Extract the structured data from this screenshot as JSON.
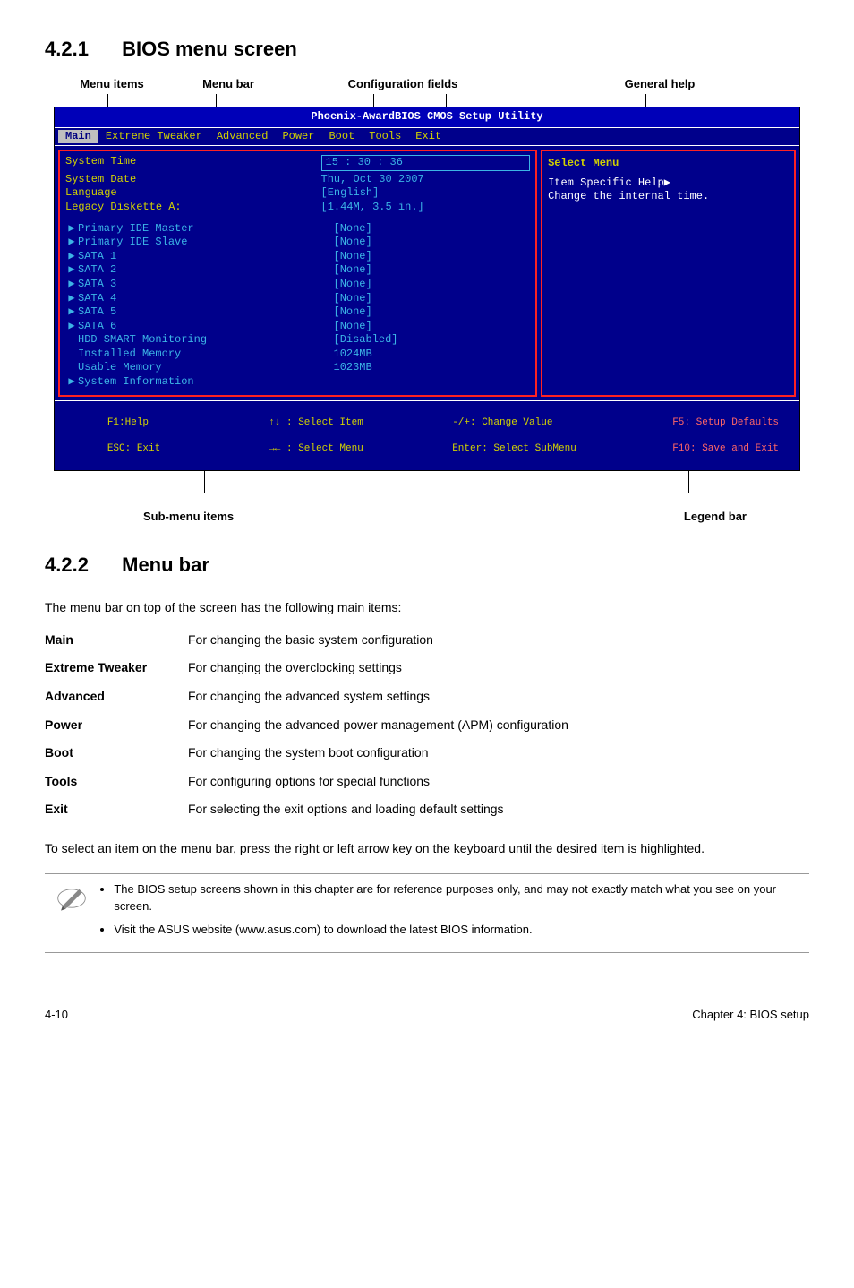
{
  "section1": {
    "number": "4.2.1",
    "title": "BIOS menu screen"
  },
  "labels_top": {
    "items": "Menu items",
    "bar": "Menu bar",
    "fields": "Configuration fields",
    "help": "General help"
  },
  "bios": {
    "title": "Phoenix-AwardBIOS CMOS Setup Utility",
    "menubar": [
      "Main",
      "Extreme Tweaker",
      "Advanced",
      "Power",
      "Boot",
      "Tools",
      "Exit"
    ],
    "menubar_selected": 0,
    "rows": [
      {
        "type": "top",
        "label": "System Time",
        "value": "15 : 30 : 36"
      },
      {
        "type": "top",
        "label": "System Date",
        "value": "Thu, Oct 30 2007"
      },
      {
        "type": "top",
        "label": "Language",
        "value": "[English]"
      },
      {
        "type": "top",
        "label": "Legacy Diskette A:",
        "value": "[1.44M, 3.5 in.]"
      },
      {
        "type": "spacer"
      },
      {
        "type": "sub",
        "label": "Primary IDE Master",
        "value": "[None]"
      },
      {
        "type": "sub",
        "label": "Primary IDE Slave",
        "value": "[None]"
      },
      {
        "type": "sub",
        "label": "SATA 1",
        "value": "[None]"
      },
      {
        "type": "sub",
        "label": "SATA 2",
        "value": "[None]"
      },
      {
        "type": "sub",
        "label": "SATA 3",
        "value": "[None]"
      },
      {
        "type": "sub",
        "label": "SATA 4",
        "value": "[None]"
      },
      {
        "type": "sub",
        "label": "SATA 5",
        "value": "[None]"
      },
      {
        "type": "sub",
        "label": "SATA 6",
        "value": "[None]"
      },
      {
        "type": "plain",
        "label": "HDD SMART Monitoring",
        "value": "[Disabled]"
      },
      {
        "type": "plain",
        "label": "Installed Memory",
        "value": "1024MB"
      },
      {
        "type": "plain",
        "label": "Usable Memory",
        "value": "1023MB"
      },
      {
        "type": "sub",
        "label": "System Information",
        "value": ""
      }
    ],
    "right": {
      "title": "Select Menu",
      "help_label": "Item Specific Help",
      "help_text": "Change the internal time."
    },
    "footer": {
      "f1": "F1:Help",
      "esc": "ESC: Exit",
      "selitem": "↑↓ : Select Item",
      "selmenu": "→← : Select Menu",
      "change": "-/+: Change Value",
      "enter": "Enter: Select SubMenu",
      "f5": "F5: Setup Defaults",
      "f10": "F10: Save and Exit"
    }
  },
  "labels_bottom": {
    "submenu": "Sub-menu items",
    "legend": "Legend bar"
  },
  "section2": {
    "number": "4.2.2",
    "title": "Menu bar"
  },
  "menubar_intro": "The menu bar on top of the screen has the following main items:",
  "menubar_items": [
    {
      "key": "Main",
      "desc": "For changing the basic system configuration"
    },
    {
      "key": "Extreme Tweaker",
      "desc": "For changing the overclocking settings"
    },
    {
      "key": "Advanced",
      "desc": "For changing the advanced system settings"
    },
    {
      "key": "Power",
      "desc": "For changing the advanced power management (APM) configuration"
    },
    {
      "key": "Boot",
      "desc": "For changing the system boot configuration"
    },
    {
      "key": "Tools",
      "desc": "For configuring options for special functions"
    },
    {
      "key": "Exit",
      "desc": "For selecting the exit options and loading default settings"
    }
  ],
  "select_para": "To select an item on the menu bar, press the right or left arrow key on the keyboard until the desired item is highlighted.",
  "notes": [
    "The BIOS setup screens shown in this chapter are for reference purposes only, and may not exactly match what you see on your screen.",
    "Visit the ASUS website (www.asus.com) to download the latest BIOS information."
  ],
  "footer": {
    "left": "4-10",
    "right": "Chapter 4: BIOS setup"
  }
}
